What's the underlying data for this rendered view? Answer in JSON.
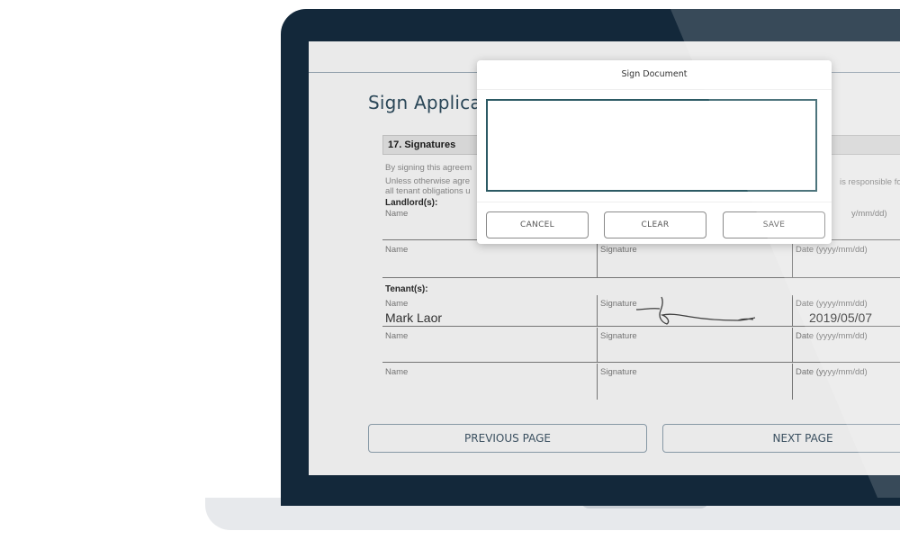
{
  "page": {
    "title": "Sign Applicatio",
    "section_title": "17. Signatures",
    "para1": "By signing this agreem",
    "para2_line1": "Unless otherwise agre",
    "para2_line2": "all tenant obligations u",
    "para2_right_fragment": "is responsible fo",
    "landlords_label": "Landlord(s):",
    "tenants_label": "Tenant(s):",
    "labels": {
      "name": "Name",
      "signature": "Signature",
      "date": "Date (yyyy/mm/dd)",
      "date_partial": "y/mm/dd)"
    },
    "tenant1": {
      "name": "Mark Laor",
      "date": "2019/05/07"
    },
    "previous_page": "PREVIOUS PAGE",
    "next_page": "NEXT PAGE"
  },
  "modal": {
    "title": "Sign Document",
    "cancel_label": "CANCEL",
    "clear_label": "CLEAR",
    "save_label": "SAVE"
  },
  "colors": {
    "laptop_frame": "#13283a",
    "laptop_base": "#e7e9ec",
    "accent_teal": "#2c5a64",
    "page_title": "#2d4a5c"
  }
}
